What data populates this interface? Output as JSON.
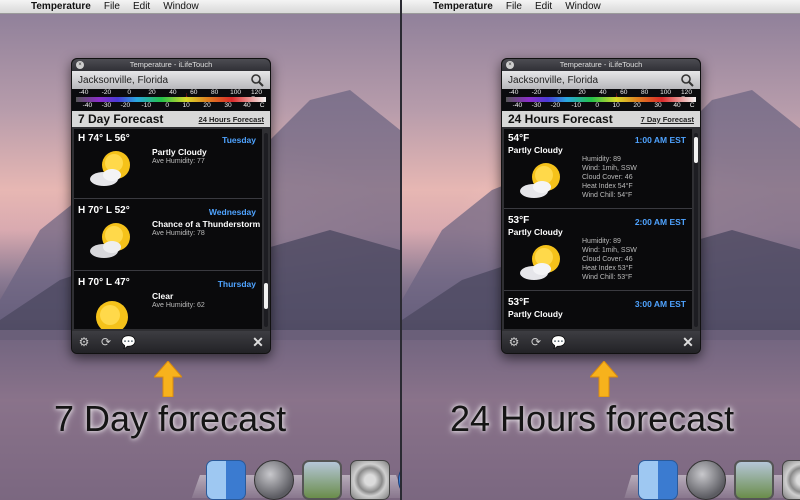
{
  "menubar": {
    "app": "Temperature",
    "items": [
      "File",
      "Edit",
      "Window"
    ]
  },
  "widget": {
    "title": "Temperature - iLifeTouch",
    "city": "Jacksonville, Florida",
    "scale_f": [
      "-40",
      "-20",
      "0",
      "20",
      "40",
      "60",
      "80",
      "100",
      "120 F"
    ],
    "scale_c": [
      "-40",
      "-30",
      "-20",
      "-10",
      "0",
      "10",
      "20",
      "30",
      "40",
      "C"
    ],
    "marker": "↓"
  },
  "left": {
    "heading": "7 Day Forecast",
    "link": "24 Hours Forecast",
    "days": [
      {
        "hl": "H 74° L 56°",
        "day": "Tuesday",
        "cond": "Partly Cloudy",
        "humidity": "Ave Humidity: 77"
      },
      {
        "hl": "H 70° L 52°",
        "day": "Wednesday",
        "cond": "Chance of a Thunderstorm",
        "humidity": "Ave Humidity: 78"
      },
      {
        "hl": "H 70° L 47°",
        "day": "Thursday",
        "cond": "Clear",
        "humidity": "Ave Humidity: 62"
      }
    ],
    "caption": "7 Day forecast"
  },
  "right": {
    "heading": "24 Hours Forecast",
    "link": "7 Day Forecast",
    "hours": [
      {
        "temp": "54°F",
        "cond": "Partly Cloudy",
        "time": "1:00 AM EST",
        "details": [
          "Humidity: 89",
          "Wind: 1mih, SSW",
          "Cloud Cover: 46",
          "Heat Index 54°F",
          "Wind Chill: 54°F"
        ]
      },
      {
        "temp": "53°F",
        "cond": "Partly Cloudy",
        "time": "2:00 AM EST",
        "details": [
          "Humidity: 89",
          "Wind: 1mih, SSW",
          "Cloud Cover: 46",
          "Heat Index 53°F",
          "Wind Chill: 53°F"
        ]
      },
      {
        "temp": "53°F",
        "cond": "Partly Cloudy",
        "time": "3:00 AM EST",
        "details": []
      }
    ],
    "caption": "24 Hours forecast"
  }
}
